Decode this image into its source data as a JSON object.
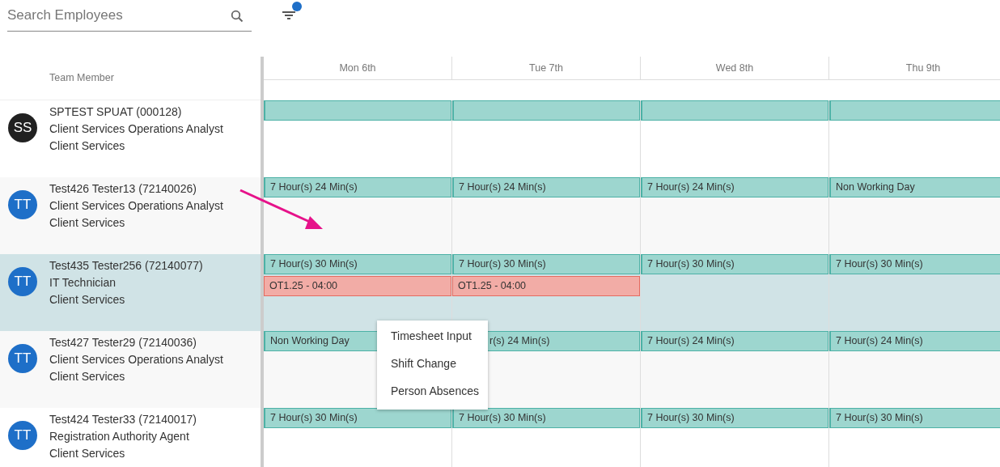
{
  "search": {
    "placeholder": "Search Employees"
  },
  "filter": {
    "active": true
  },
  "table": {
    "member_heading": "Team Member",
    "days": [
      "Mon 6th",
      "Tue 7th",
      "Wed 8th",
      "Thu 9th"
    ],
    "rows": [
      {
        "initials": "SS",
        "color": "#212121",
        "name": "SPTEST SPUAT (000128)",
        "title": "Client Services Operations Analyst",
        "department": "Client Services",
        "selected": false,
        "days": [
          [
            {
              "kind": "shift"
            }
          ],
          [
            {
              "kind": "shift"
            }
          ],
          [
            {
              "kind": "shift"
            }
          ],
          [
            {
              "kind": "shift"
            }
          ]
        ]
      },
      {
        "initials": "TT",
        "color": "#1e6fc8",
        "name": "Test426 Tester13 (72140026)",
        "title": "Client Services Operations Analyst",
        "department": "Client Services",
        "selected": false,
        "days": [
          [
            {
              "kind": "shift",
              "label": "7 Hour(s) 24 Min(s)"
            }
          ],
          [
            {
              "kind": "shift",
              "label": "7 Hour(s) 24 Min(s)"
            }
          ],
          [
            {
              "kind": "shift",
              "label": "7 Hour(s) 24 Min(s)"
            }
          ],
          [
            {
              "kind": "shift",
              "label": "Non Working Day"
            }
          ]
        ]
      },
      {
        "initials": "TT",
        "color": "#1e6fc8",
        "name": "Test435 Tester256 (72140077)",
        "title": "IT Technician",
        "department": "Client Services",
        "selected": true,
        "days": [
          [
            {
              "kind": "shift",
              "label": "7 Hour(s) 30 Min(s)"
            },
            {
              "kind": "overtime",
              "label": "OT1.25 - 04:00"
            }
          ],
          [
            {
              "kind": "shift",
              "label": "7 Hour(s) 30 Min(s)"
            },
            {
              "kind": "overtime",
              "label": "OT1.25 - 04:00"
            }
          ],
          [
            {
              "kind": "shift",
              "label": "7 Hour(s) 30 Min(s)"
            }
          ],
          [
            {
              "kind": "shift",
              "label": "7 Hour(s) 30 Min(s)"
            }
          ]
        ]
      },
      {
        "initials": "TT",
        "color": "#1e6fc8",
        "name": "Test427 Tester29 (72140036)",
        "title": "Client Services Operations Analyst",
        "department": "Client Services",
        "selected": false,
        "days": [
          [
            {
              "kind": "shift",
              "label": "Non Working Day"
            }
          ],
          [
            {
              "kind": "shift",
              "label": "r(s) 24 Min(s)",
              "partly_covered": true
            }
          ],
          [
            {
              "kind": "shift",
              "label": "7 Hour(s) 24 Min(s)"
            }
          ],
          [
            {
              "kind": "shift",
              "label": "7 Hour(s) 24 Min(s)"
            }
          ]
        ]
      },
      {
        "initials": "TT",
        "color": "#1e6fc8",
        "name": "Test424 Tester33 (72140017)",
        "title": "Registration Authority Agent",
        "department": "Client Services",
        "selected": false,
        "days": [
          [
            {
              "kind": "shift",
              "label": "7 Hour(s) 30 Min(s)"
            }
          ],
          [
            {
              "kind": "shift",
              "label": "7 Hour(s) 30 Min(s)"
            }
          ],
          [
            {
              "kind": "shift",
              "label": "7 Hour(s) 30 Min(s)"
            }
          ],
          [
            {
              "kind": "shift",
              "label": "7 Hour(s) 30 Min(s)"
            }
          ]
        ]
      }
    ]
  },
  "context_menu": {
    "items": [
      "Timesheet Input",
      "Shift Change",
      "Person Absences"
    ]
  }
}
